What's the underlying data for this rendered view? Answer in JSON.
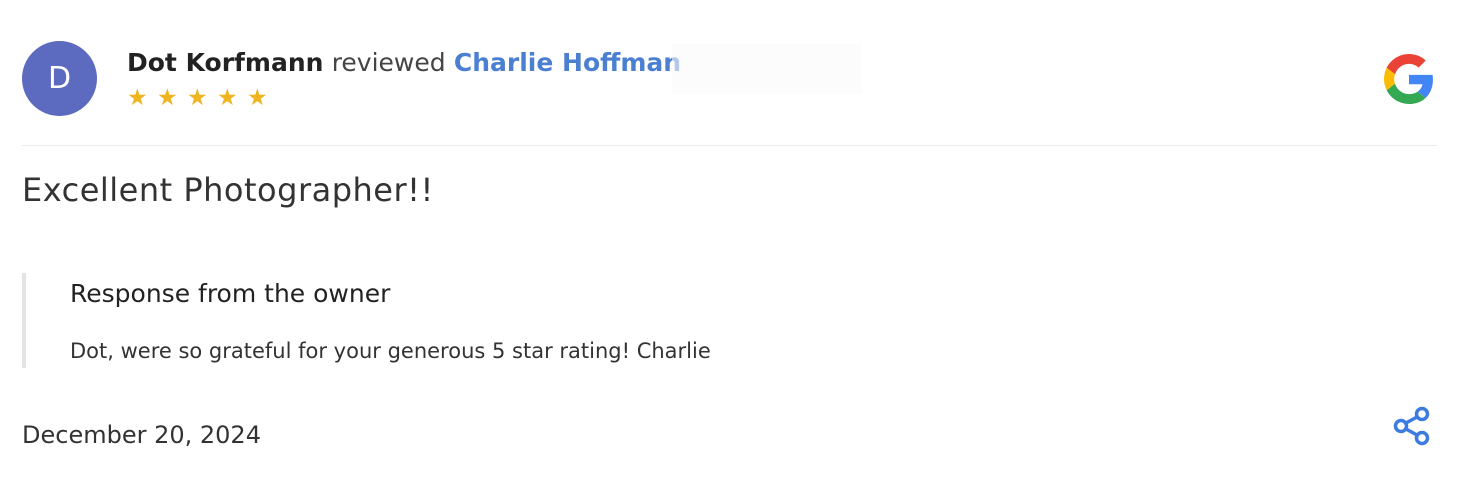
{
  "review": {
    "avatar_letter": "D",
    "reviewer_name": "Dot Korfmann",
    "verb": "reviewed",
    "business_name": "Charlie Hoffman",
    "rating": 5,
    "stars": [
      "★",
      "★",
      "★",
      "★",
      "★"
    ],
    "text": "Excellent Photographer!!",
    "date": "December 20, 2024"
  },
  "response": {
    "title": "Response from the owner",
    "text": "Dot, were so grateful for your generous 5 star rating! Charlie"
  },
  "icons": {
    "source": "google-logo-icon",
    "share": "share-icon"
  },
  "colors": {
    "avatar": "#5c6bc0",
    "link": "#4a7fd1",
    "star": "#efb521",
    "share": "#3c7be0"
  }
}
